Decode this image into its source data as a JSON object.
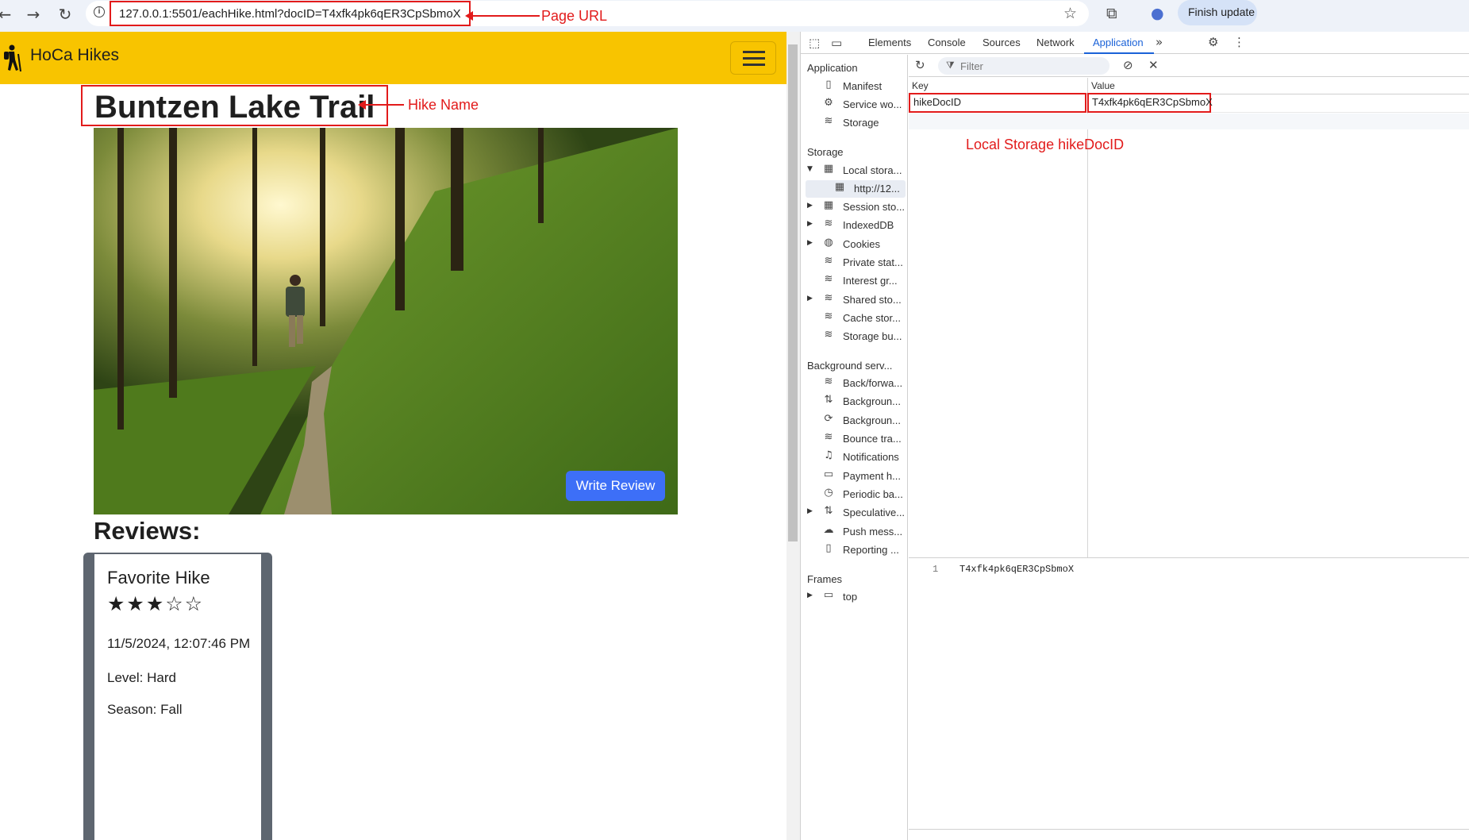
{
  "browser": {
    "url": "127.0.0.1:5501/eachHike.html?docID=T4xfk4pk6qER3CpSbmoX",
    "update_button": "Finish update"
  },
  "annotations": {
    "page_url": "Page URL",
    "hike_name": "Hike Name",
    "local_storage": "Local Storage hikeDocID"
  },
  "site": {
    "brand": "HoCa Hikes",
    "hike_title": "Buntzen Lake Trail",
    "write_review": "Write Review",
    "reviews_heading": "Reviews:",
    "review": {
      "title": "Favorite Hike",
      "stars": "★★★☆☆",
      "rating": 3,
      "max_rating": 5,
      "date": "11/5/2024, 12:07:46 PM",
      "level": "Level: Hard",
      "season": "Season: Fall"
    }
  },
  "devtools": {
    "tabs": [
      "Elements",
      "Console",
      "Sources",
      "Network",
      "Application"
    ],
    "active_tab": "Application",
    "filter_placeholder": "Filter",
    "sections": {
      "application": "Application",
      "storage": "Storage",
      "background": "Background serv...",
      "frames": "Frames"
    },
    "application_items": [
      "Manifest",
      "Service wo...",
      "Storage"
    ],
    "storage_items": [
      "Local stora...",
      "http://12...",
      "Session sto...",
      "IndexedDB",
      "Cookies",
      "Private stat...",
      "Interest gr...",
      "Shared sto...",
      "Cache stor...",
      "Storage bu..."
    ],
    "background_items": [
      "Back/forwa...",
      "Backgroun...",
      "Backgroun...",
      "Bounce tra...",
      "Notifications",
      "Payment h...",
      "Periodic ba...",
      "Speculative...",
      "Push mess...",
      "Reporting ..."
    ],
    "frames_items": [
      "top"
    ],
    "table": {
      "headers": [
        "Key",
        "Value"
      ],
      "rows": [
        {
          "key": "hikeDocID",
          "value": "T4xfk4pk6qER3CpSbmoX"
        }
      ]
    },
    "preview": {
      "line": "1",
      "value": "T4xfk4pk6qER3CpSbmoX"
    }
  }
}
